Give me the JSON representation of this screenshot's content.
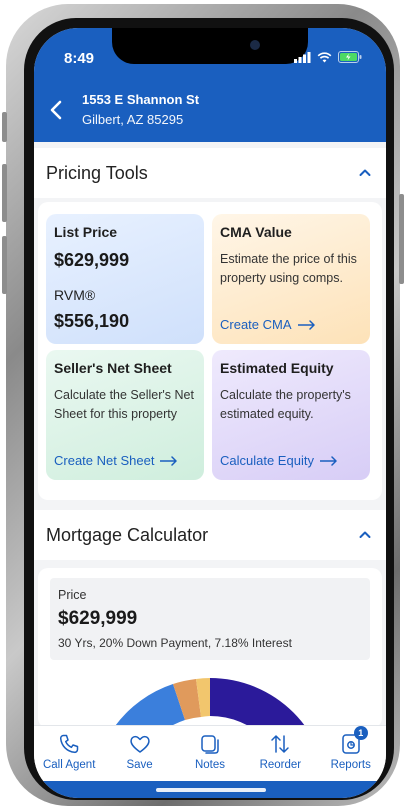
{
  "status": {
    "time": "8:49"
  },
  "header": {
    "street": "1553 E Shannon St",
    "city": "Gilbert, AZ 85295"
  },
  "pricing_tools": {
    "title": "Pricing Tools",
    "list_price": {
      "label": "List Price",
      "value": "$629,999",
      "rvm_label": "RVM®",
      "rvm_value": "$556,190"
    },
    "cma": {
      "title": "CMA Value",
      "desc": "Estimate the price of this property using comps.",
      "link": "Create CMA"
    },
    "net_sheet": {
      "title": "Seller's Net Sheet",
      "desc": "Calculate the Seller's Net Sheet for this property",
      "link": "Create Net Sheet"
    },
    "equity": {
      "title": "Estimated Equity",
      "desc": "Calculate the property's estimated equity.",
      "link": "Calculate Equity"
    }
  },
  "mortgage": {
    "title": "Mortgage Calculator",
    "price_label": "Price",
    "price_value": "$629,999",
    "details": "30 Yrs, 20% Down Payment, 7.18% Interest",
    "donut_colors": [
      "#3b7fdc",
      "#e09a5c",
      "#f2c66d",
      "#2b1a9a"
    ]
  },
  "nav": {
    "call": "Call Agent",
    "save": "Save",
    "notes": "Notes",
    "reorder": "Reorder",
    "reports": "Reports",
    "reports_badge": "1"
  },
  "colors": {
    "brand": "#1a5fbf"
  }
}
